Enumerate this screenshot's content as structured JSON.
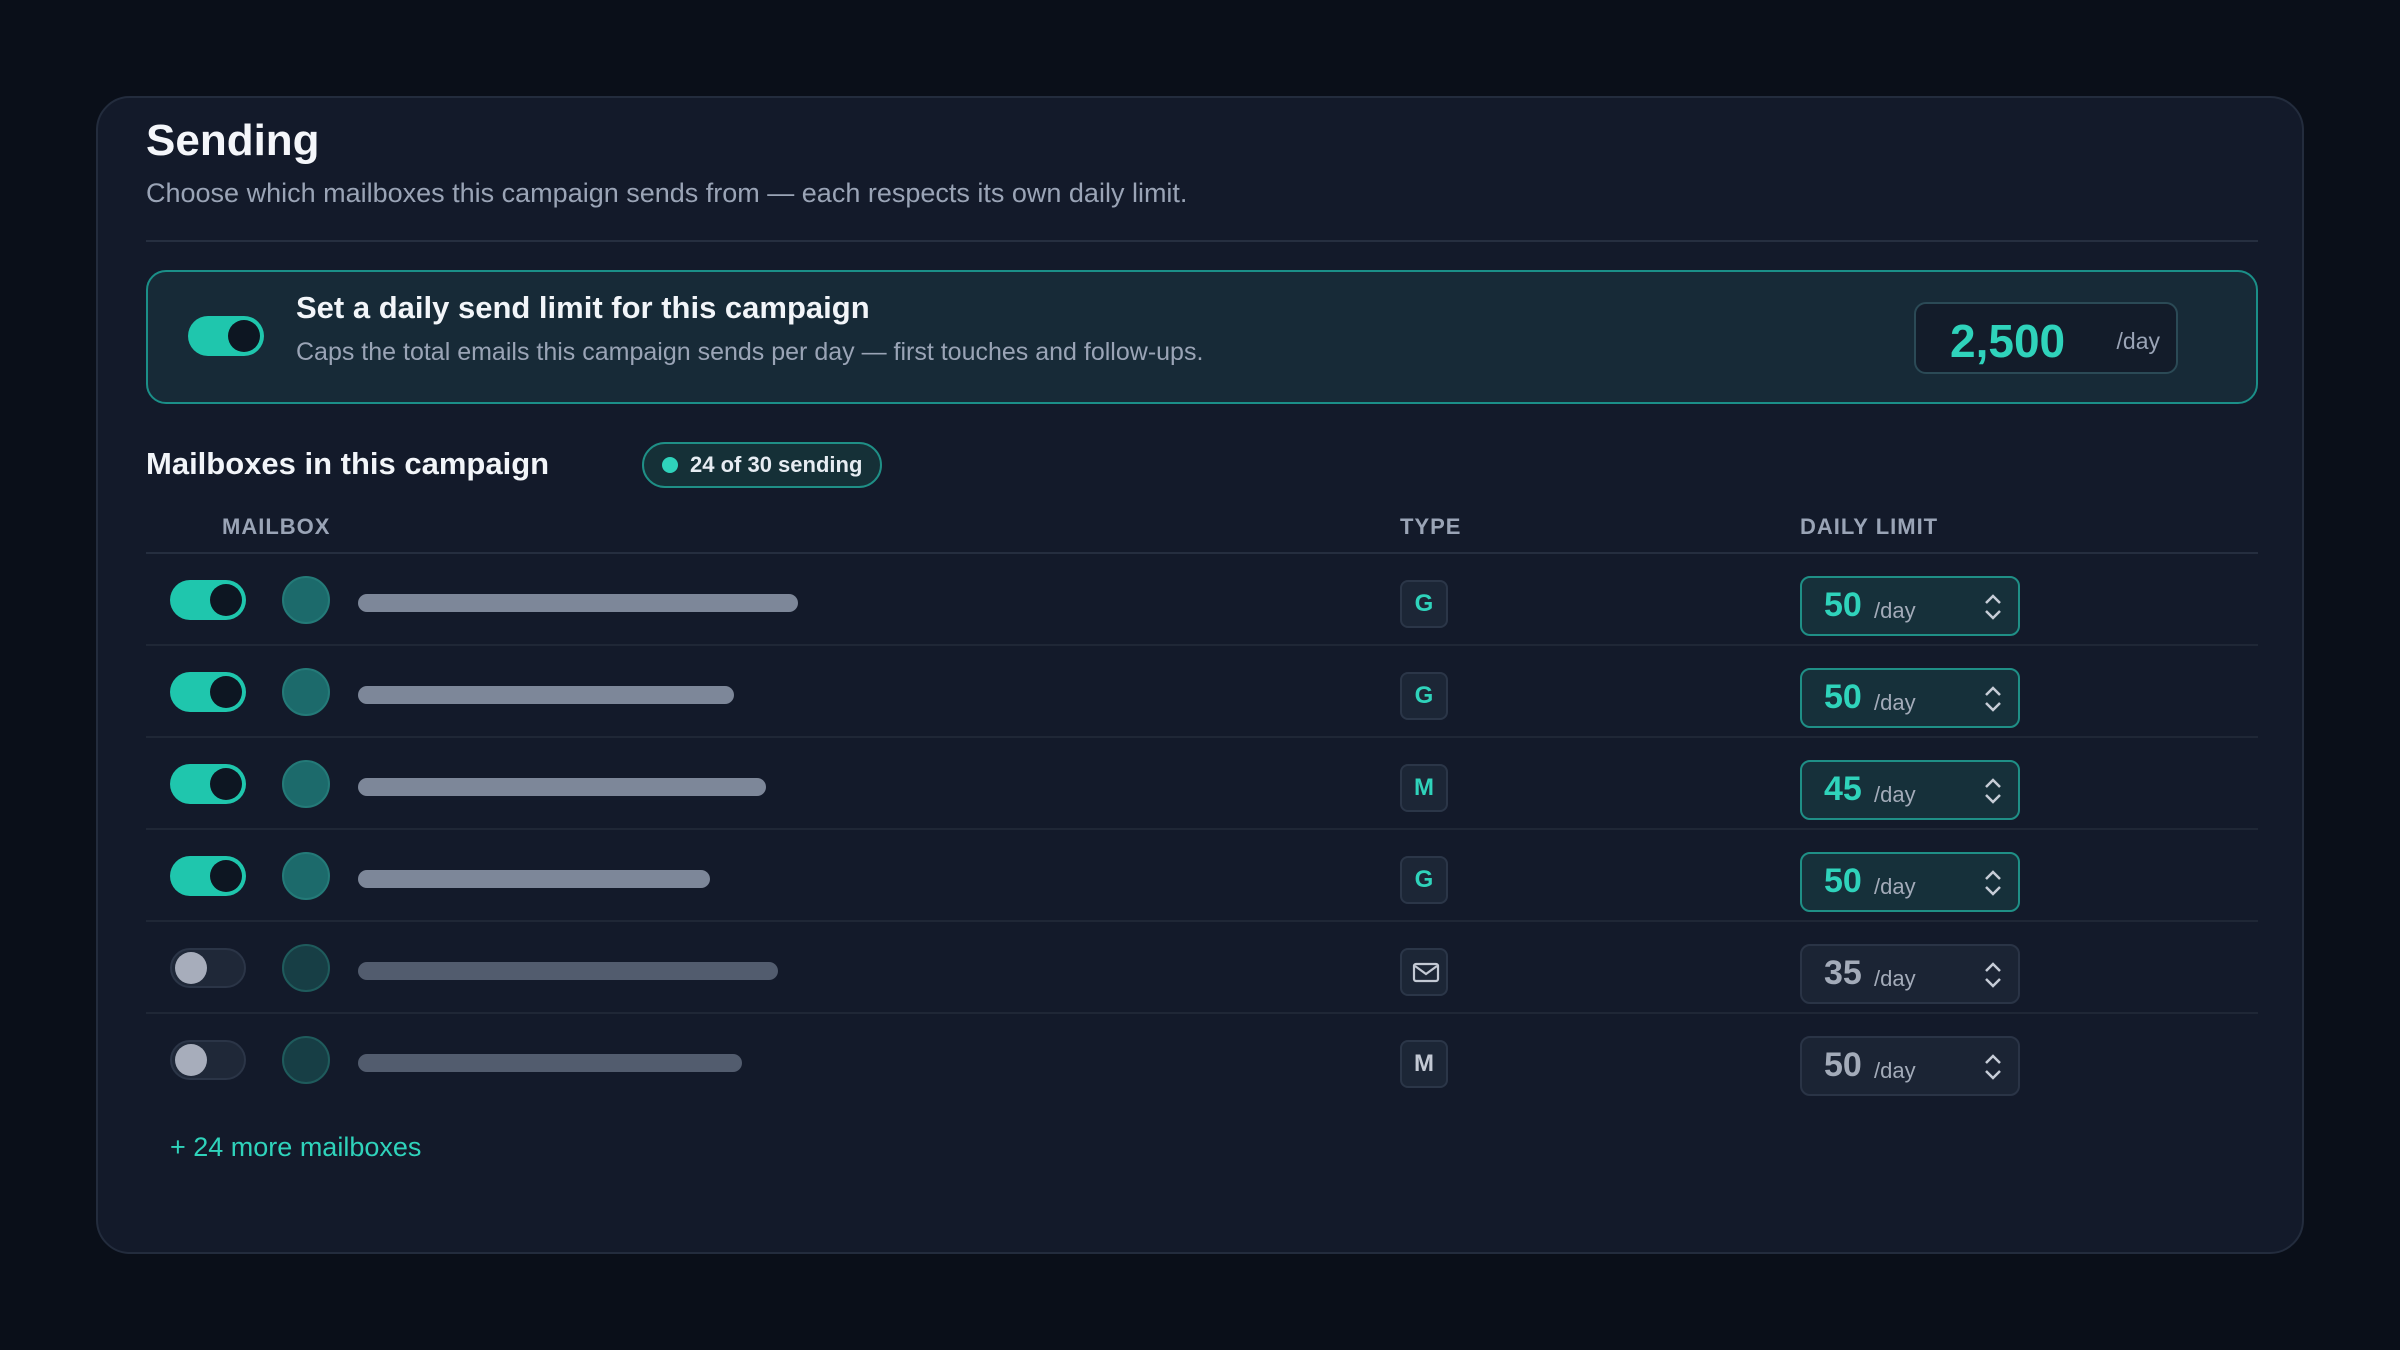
{
  "header": {
    "title": "Sending",
    "subtitle": "Choose which mailboxes this campaign sends from — each respects its own daily limit."
  },
  "campaign_limit": {
    "enabled": true,
    "title": "Set a daily send limit for this campaign",
    "description": "Caps the total emails this campaign sends per day — first touches and follow-ups.",
    "value": "2,500",
    "unit": "/day"
  },
  "mailboxes": {
    "title": "Mailboxes in this campaign",
    "badge": "24 of 30 sending",
    "columns": {
      "mailbox": "MAILBOX",
      "type": "TYPE",
      "daily_limit": "DAILY LIMIT"
    },
    "rows": [
      {
        "enabled": true,
        "type": "G",
        "limit": "50",
        "unit": "/day"
      },
      {
        "enabled": true,
        "type": "G",
        "limit": "50",
        "unit": "/day"
      },
      {
        "enabled": true,
        "type": "M",
        "limit": "45",
        "unit": "/day"
      },
      {
        "enabled": true,
        "type": "G",
        "limit": "50",
        "unit": "/day"
      },
      {
        "enabled": false,
        "type": "envelope-icon",
        "limit": "35",
        "unit": "/day"
      },
      {
        "enabled": false,
        "type": "M",
        "limit": "50",
        "unit": "/day"
      }
    ],
    "more_link": "+ 24 more mailboxes"
  },
  "colors": {
    "accent": "#2fd3bb",
    "background": "#0a0f19",
    "card": "#131a2a"
  }
}
